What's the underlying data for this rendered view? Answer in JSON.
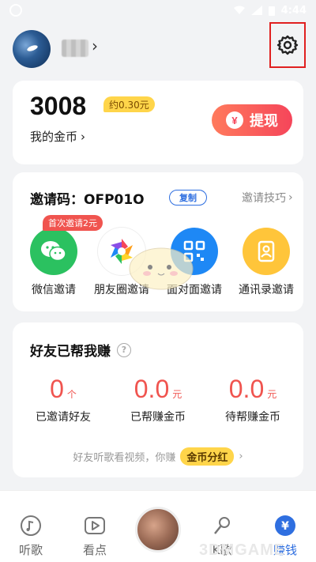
{
  "status_bar": {
    "time": "4:44"
  },
  "header": {
    "settings_icon": "gear-icon"
  },
  "coins": {
    "amount": "3008",
    "approx": "约0.30元",
    "my_coins_label": "我的金币",
    "withdraw_label": "提现",
    "withdraw_icon": "yen-icon"
  },
  "invite": {
    "title": "邀请码：OFP01O",
    "copy_label": "复制",
    "tips_label": "邀请技巧",
    "first_invite_badge": "首次邀请2元",
    "options": [
      {
        "label": "微信邀请",
        "icon": "wechat-icon",
        "color": "#2bc160"
      },
      {
        "label": "朋友圈邀请",
        "icon": "moments-icon",
        "color": "#ffffff"
      },
      {
        "label": "面对面邀请",
        "icon": "qrcode-icon",
        "color": "#1e88f5"
      },
      {
        "label": "通讯录邀请",
        "icon": "contacts-icon",
        "color": "#ffc53a"
      }
    ]
  },
  "friends": {
    "title": "好友已帮我赚",
    "stats": [
      {
        "value": "0",
        "unit": "个",
        "label": "已邀请好友"
      },
      {
        "value": "0.0",
        "unit": "元",
        "label": "已帮赚金币"
      },
      {
        "value": "0.0",
        "unit": "元",
        "label": "待帮赚金币"
      }
    ],
    "footer_text": "好友听歌看视频，你赚",
    "footer_pill": "金币分红"
  },
  "bottom_nav": {
    "items": [
      {
        "label": "听歌",
        "icon": "music-note-icon"
      },
      {
        "label": "看点",
        "icon": "play-icon"
      },
      {
        "label": "K歌",
        "icon": "microphone-icon"
      },
      {
        "label": "赚钱",
        "icon": "yen-icon",
        "active": true
      }
    ]
  },
  "colors": {
    "accent_blue": "#2f6fe0",
    "accent_red": "#f0544f",
    "gold": "#ffd54a"
  },
  "watermark": "3DMGAME"
}
